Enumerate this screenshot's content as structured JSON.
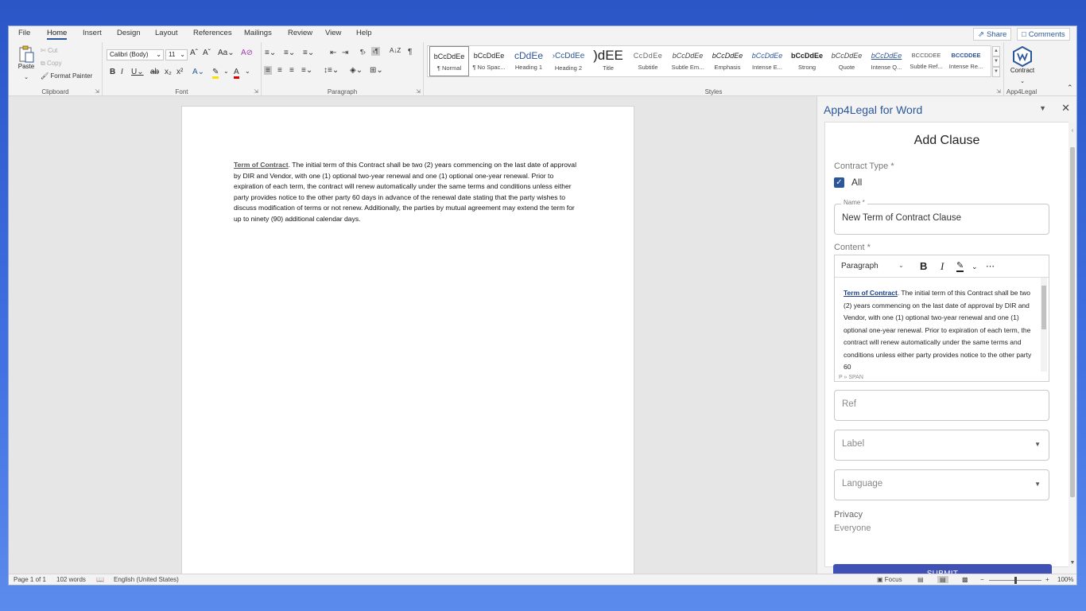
{
  "tabs": [
    "File",
    "Home",
    "Insert",
    "Design",
    "Layout",
    "References",
    "Mailings",
    "Review",
    "View",
    "Help"
  ],
  "active_tab": "Home",
  "share_label": "Share",
  "comments_label": "Comments",
  "clipboard": {
    "paste": "Paste",
    "cut": "Cut",
    "copy": "Copy",
    "format_painter": "Format Painter",
    "group_label": "Clipboard"
  },
  "font": {
    "name": "Calibri (Body)",
    "size": "11",
    "group_label": "Font"
  },
  "paragraph": {
    "group_label": "Paragraph"
  },
  "styles": {
    "group_label": "Styles",
    "items": [
      {
        "preview": "bCcDdEe",
        "name": "¶ Normal"
      },
      {
        "preview": "bCcDdEe",
        "name": "¶ No Spac..."
      },
      {
        "preview": "cDdEe",
        "name": "Heading 1"
      },
      {
        "preview": "›CcDdEe",
        "name": "Heading 2"
      },
      {
        "preview": ")dEE",
        "name": "Title"
      },
      {
        "preview": "CcDdEe",
        "name": "Subtitle"
      },
      {
        "preview": "bCcDdEe",
        "name": "Subtle Em..."
      },
      {
        "preview": "bCcDdEe",
        "name": "Emphasis"
      },
      {
        "preview": "bCcDdEe",
        "name": "Intense E..."
      },
      {
        "preview": "bCcDdEe",
        "name": "Strong"
      },
      {
        "preview": "bCcDdEe",
        "name": "Quote"
      },
      {
        "preview": "bCcDdEe",
        "name": "Intense Q..."
      },
      {
        "preview": "bCcDdEe",
        "name": "Subtle Ref..."
      },
      {
        "preview": "bCcDdEe",
        "name": "Intense Re..."
      }
    ]
  },
  "addin_group": {
    "button": "Contract",
    "group_label": "App4Legal"
  },
  "document": {
    "heading_run": "Term of Contract",
    "body": ". The initial term of this Contract shall be two (2) years commencing on the last date of approval by DIR and Vendor, with one (1) optional two-year renewal and one (1) optional one-year renewal. Prior to expiration of each term, the contract will renew automatically under the same terms and conditions unless either party provides notice to the other party 60 days in advance of the renewal date stating that the party wishes to discuss modification of terms or not renew. Additionally, the parties by mutual agreement may extend the term for up to ninety (90) additional calendar days."
  },
  "pane": {
    "title": "App4Legal for Word",
    "form_title": "Add Clause",
    "contract_type_label": "Contract Type *",
    "contract_type_option": "All",
    "name_label": "Name *",
    "name_value": "New Term of Contract Clause",
    "content_label": "Content *",
    "editor_block": "Paragraph",
    "editor_link": "Term of Contract",
    "editor_text": ". The initial term of this Contract shall be two (2) years commencing on the last date of approval by DIR and Vendor, with one (1) optional two-year renewal and one (1) optional one-year renewal. Prior to expiration of each term, the contract will renew automatically under the same terms and conditions unless either party provides notice to the other party 60",
    "editor_path": "P » SPAN",
    "ref_placeholder": "Ref",
    "label_placeholder": "Label",
    "language_placeholder": "Language",
    "privacy_label": "Privacy",
    "privacy_value": "Everyone",
    "submit_label": "SUBMIT"
  },
  "status": {
    "page": "Page 1 of 1",
    "words": "102 words",
    "language": "English (United States)",
    "focus": "Focus",
    "zoom_minus": "−",
    "zoom_plus": "+",
    "zoom": "100%"
  },
  "colors": {
    "accent": "#2b579a",
    "submit": "#3f51b5",
    "background": "#3a66d8"
  }
}
